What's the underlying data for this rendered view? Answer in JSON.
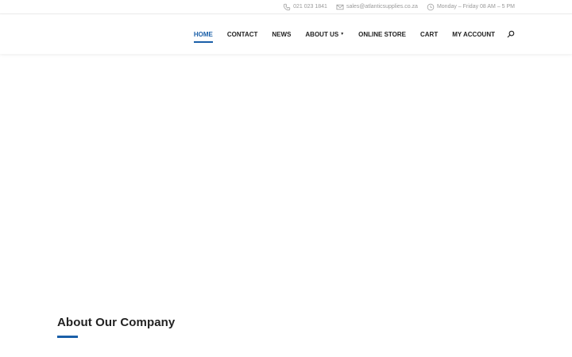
{
  "topbar": {
    "phone": {
      "icon": "phone-icon",
      "text": "021 023 1841"
    },
    "email": {
      "icon": "mail-icon",
      "text": "sales@atlanticsupplies.co.za"
    },
    "hours": {
      "icon": "clock-icon",
      "text": "Monday – Friday 08 AM – 5 PM"
    }
  },
  "nav": {
    "items": [
      {
        "label": "HOME",
        "active": true
      },
      {
        "label": "CONTACT"
      },
      {
        "label": "NEWS"
      },
      {
        "label": "ABOUT US",
        "has_dropdown": true
      },
      {
        "label": "ONLINE STORE"
      },
      {
        "label": "CART"
      },
      {
        "label": "MY ACCOUNT"
      }
    ],
    "search_icon": "search-icon"
  },
  "about": {
    "heading": "About Our Company"
  },
  "colors": {
    "accent": "#1a5fa8",
    "text": "#222222",
    "muted": "#9a9a9a"
  }
}
